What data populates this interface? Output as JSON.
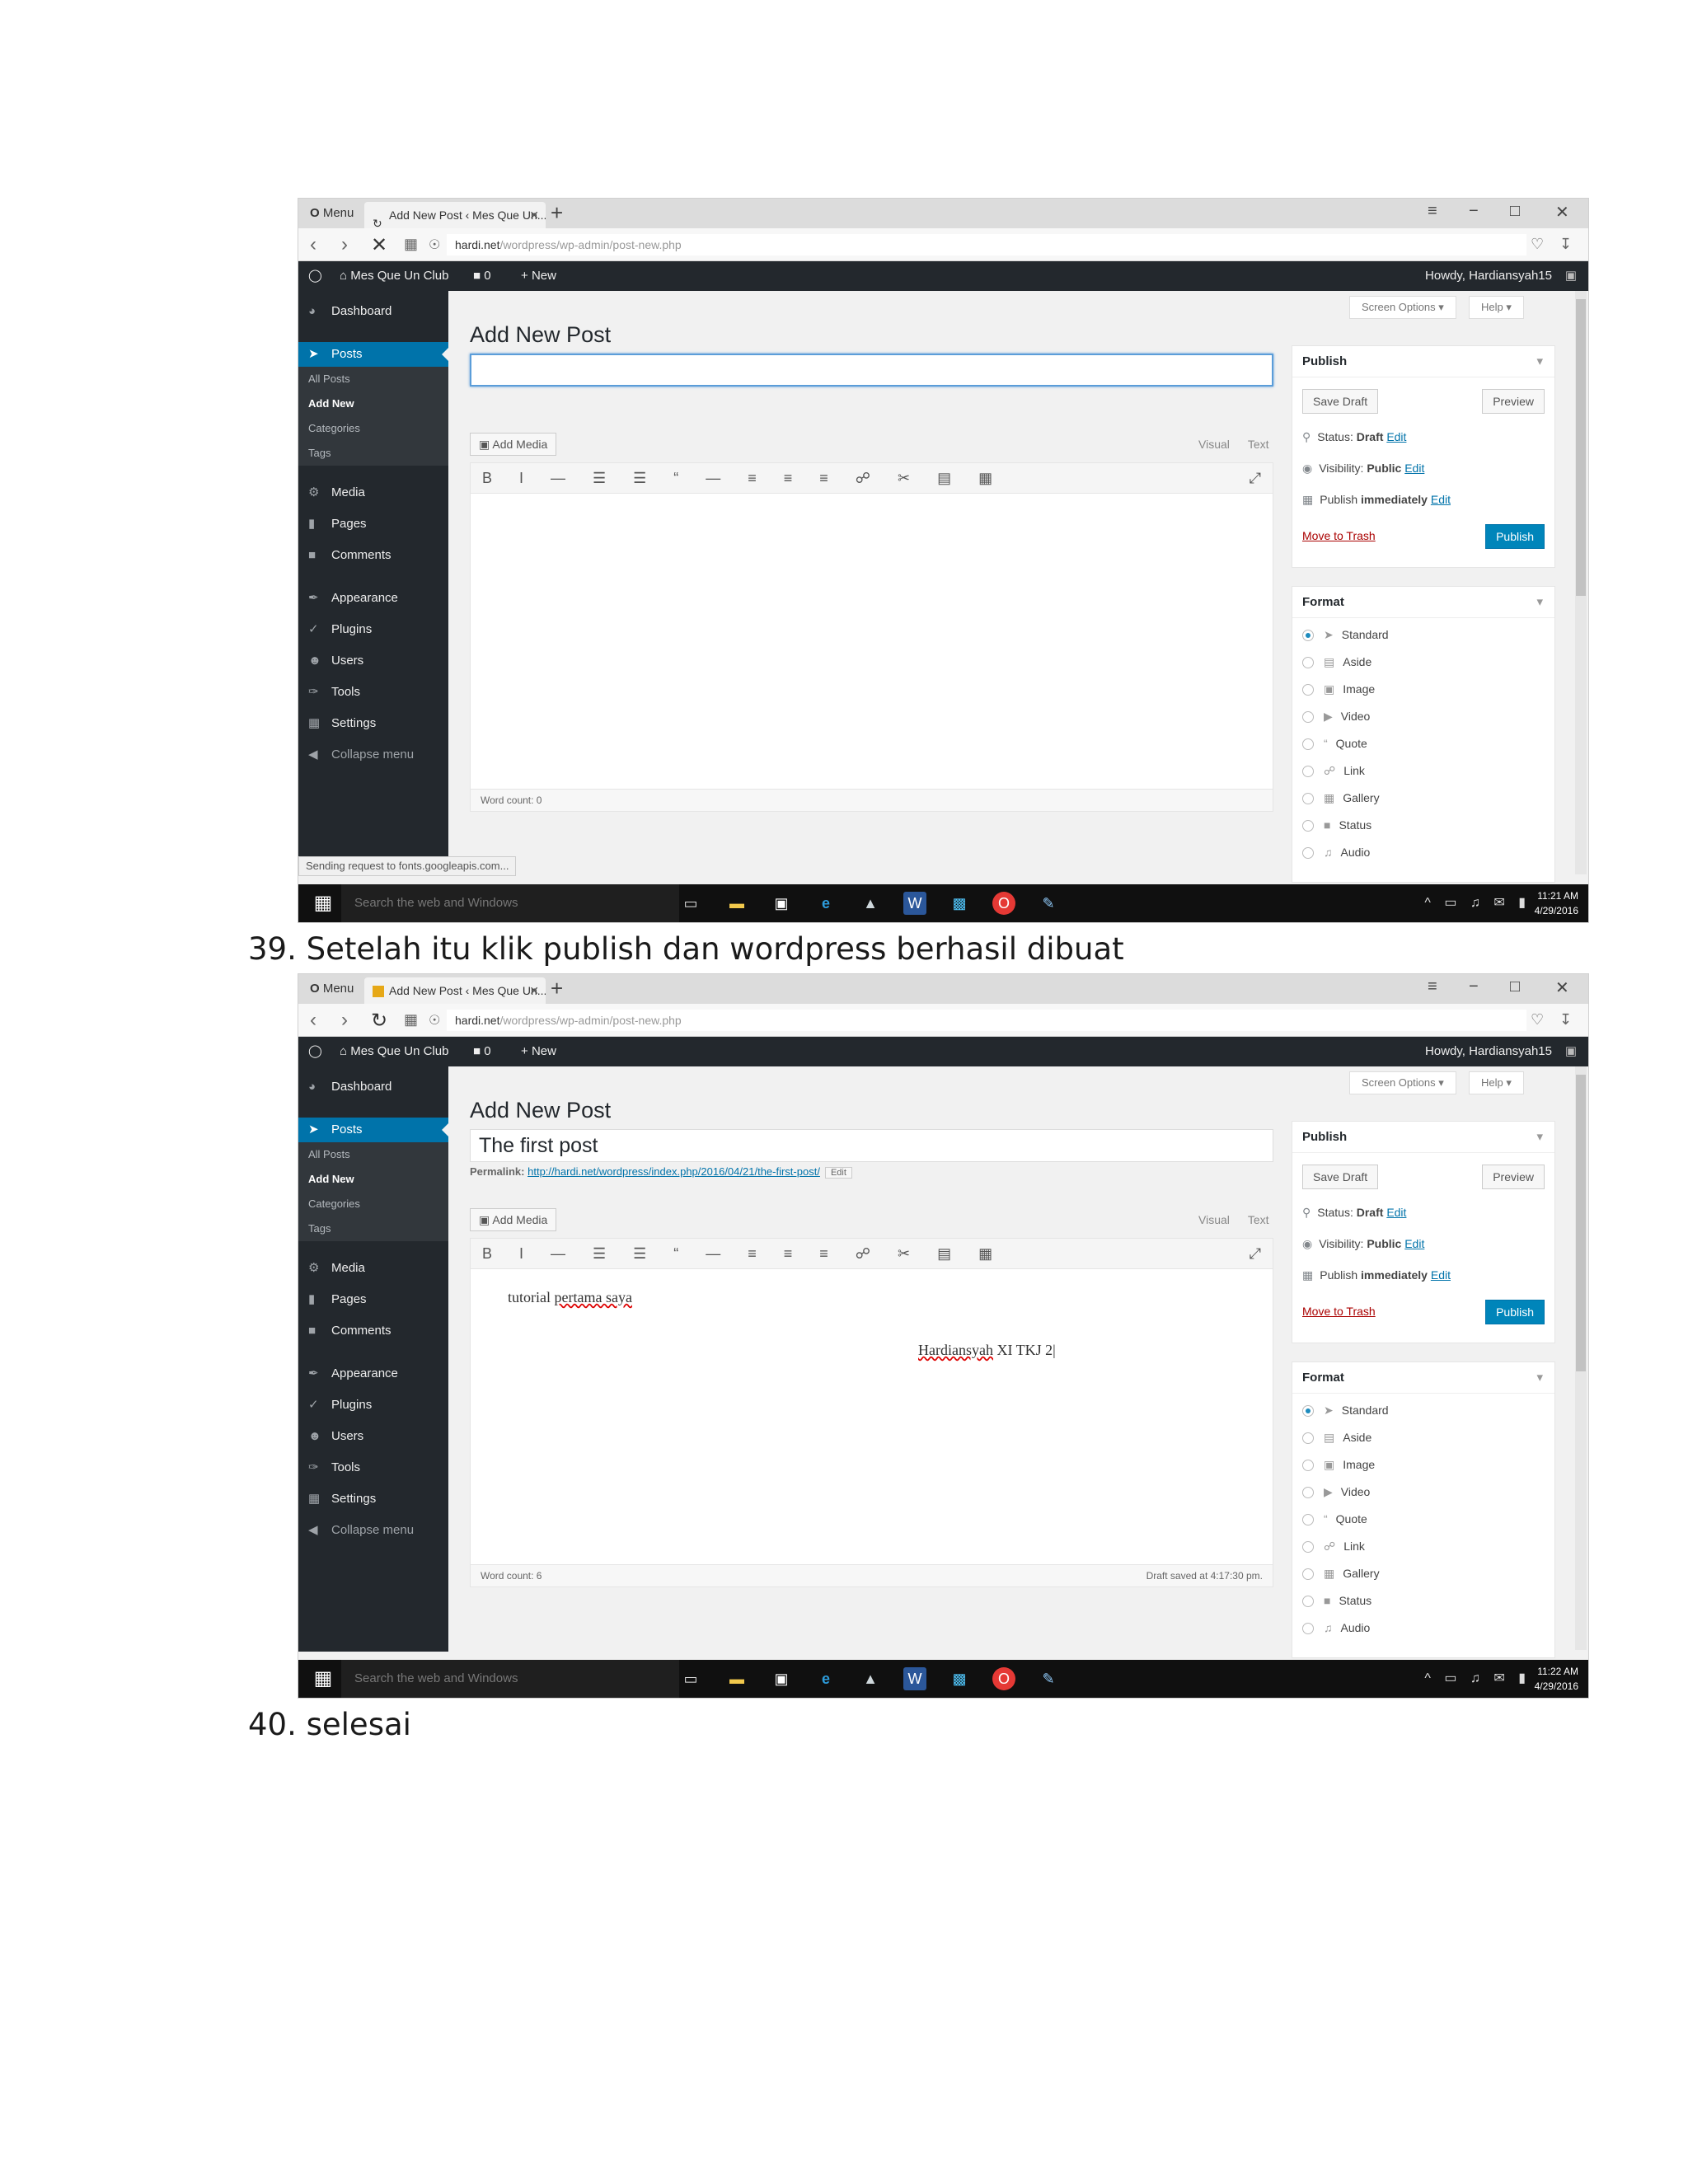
{
  "captions": {
    "step39": "39. Setelah itu klik publish dan wordpress berhasil dibuat",
    "step40": "40. selesai"
  },
  "browser": {
    "menu_label": "Menu",
    "tab_title": "Add New Post ‹ Mes Que Un...",
    "new_tab": "+",
    "url_host": "hardi.net",
    "url_path": "/wordpress/wp-admin/post-new.php",
    "window_controls": [
      "−",
      "□",
      "✕"
    ]
  },
  "admin_bar": {
    "site_name": "Mes Que Un Club",
    "comments_count": "0",
    "new_label": "New",
    "howdy": "Howdy, Hardiansyah15"
  },
  "sidebar": {
    "items": [
      {
        "label": "Dashboard",
        "icon": "dashboard-icon"
      },
      {
        "label": "Posts",
        "icon": "pin-icon"
      },
      {
        "label": "Media",
        "icon": "media-icon"
      },
      {
        "label": "Pages",
        "icon": "pages-icon"
      },
      {
        "label": "Comments",
        "icon": "comments-icon"
      },
      {
        "label": "Appearance",
        "icon": "appearance-icon"
      },
      {
        "label": "Plugins",
        "icon": "plugins-icon"
      },
      {
        "label": "Users",
        "icon": "users-icon"
      },
      {
        "label": "Tools",
        "icon": "tools-icon"
      },
      {
        "label": "Settings",
        "icon": "settings-icon"
      },
      {
        "label": "Collapse menu",
        "icon": "collapse-icon"
      }
    ],
    "posts_submenu": [
      "All Posts",
      "Add New",
      "Categories",
      "Tags"
    ]
  },
  "screen_options": "Screen Options ▾",
  "help": "Help ▾",
  "page_title": "Add New Post",
  "editor": {
    "add_media": "Add Media",
    "tab_visual": "Visual",
    "tab_text": "Text",
    "toolbar_glyphs": "B I — ☰ ☰ “ — ≡ ≡ ≡ ☍ ✂ ▤ ▦",
    "fullscreen": "⤢"
  },
  "publish_box": {
    "title": "Publish",
    "save_draft": "Save Draft",
    "preview": "Preview",
    "status_label": "Status:",
    "status_value": "Draft",
    "visibility_label": "Visibility:",
    "visibility_value": "Public",
    "publish_label": "Publish",
    "publish_value": "immediately",
    "edit": "Edit",
    "move_to_trash": "Move to Trash",
    "publish_button": "Publish"
  },
  "format_box": {
    "title": "Format",
    "options": [
      "Standard",
      "Aside",
      "Image",
      "Video",
      "Quote",
      "Link",
      "Gallery",
      "Status",
      "Audio"
    ],
    "selected": "Standard"
  },
  "taskbar": {
    "search_placeholder": "Search the web and Windows"
  },
  "screen1": {
    "title_value": "",
    "word_count": "Word count: 0",
    "loading_status": "Sending request to fonts.googleapis.com...",
    "clock_time": "11:21 AM",
    "clock_date": "4/29/2016"
  },
  "screen2": {
    "title_value": "The first post",
    "permalink_label": "Permalink:",
    "permalink_url": "http://hardi.net/wordpress/index.php/2016/04/21/the-first-post/",
    "permalink_edit": "Edit",
    "content_line1_a": "tutorial ",
    "content_line1_b": "pertama saya",
    "content_line2_a": "Hardiansyah",
    "content_line2_b": " XI TKJ 2",
    "word_count": "Word count: 6",
    "draft_saved": "Draft saved at 4:17:30 pm.",
    "clock_time": "11:22 AM",
    "clock_date": "4/29/2016"
  }
}
